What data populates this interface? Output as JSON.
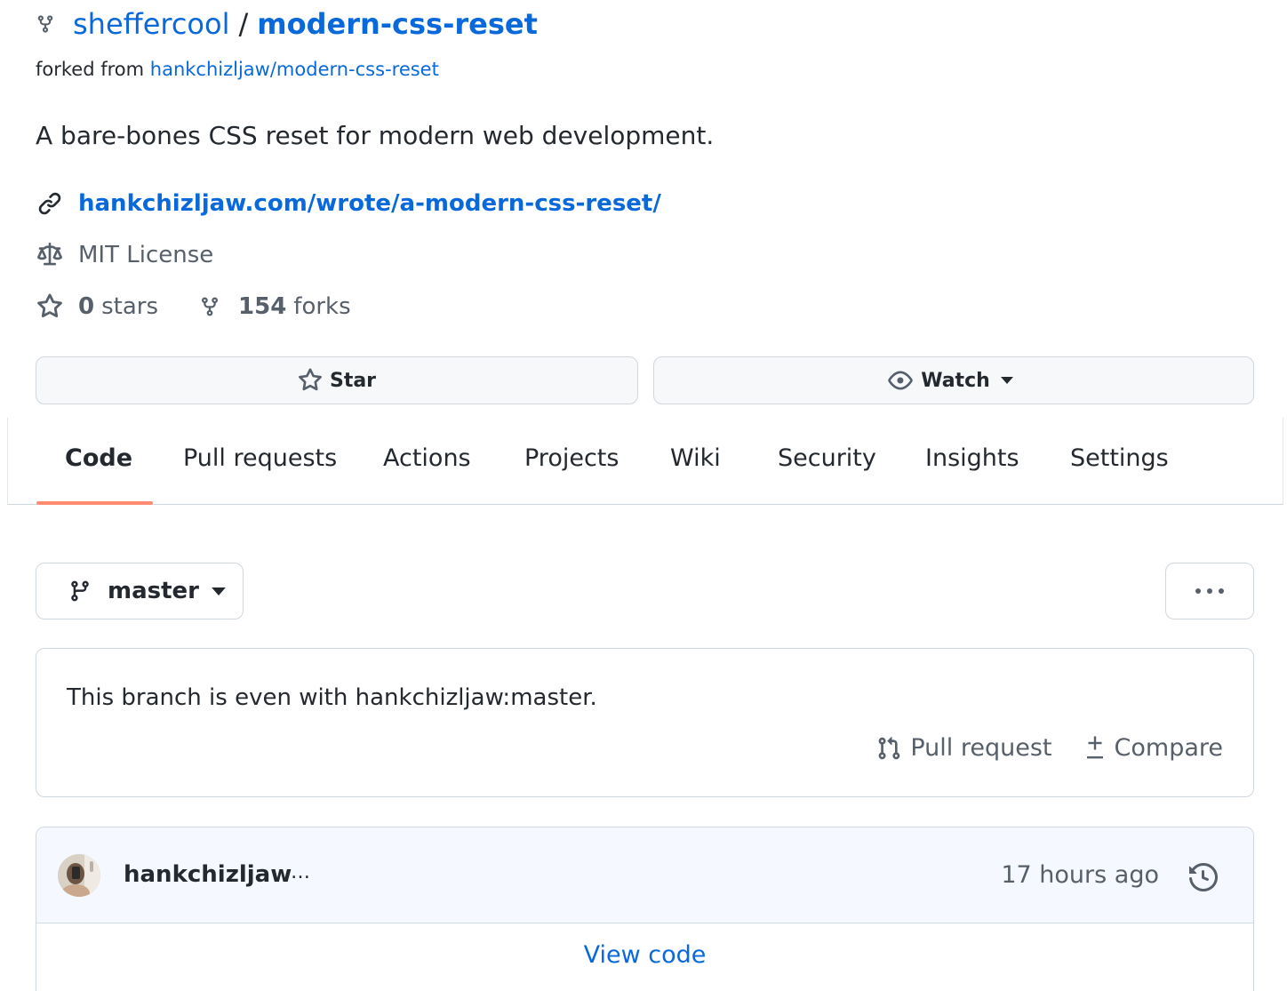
{
  "repo": {
    "owner": "sheffercool",
    "separator": "/",
    "name": "modern-css-reset",
    "forked_prefix": "forked from",
    "forked_source": "hankchizljaw/modern-css-reset",
    "description": "A bare-bones CSS reset for modern web development.",
    "website": "hankchizljaw.com/wrote/a-modern-css-reset/",
    "license": "MIT License",
    "stars_count": "0",
    "stars_label": "stars",
    "forks_count": "154",
    "forks_label": "forks"
  },
  "actions": {
    "star_label": "Star",
    "watch_label": "Watch"
  },
  "tabs": [
    {
      "label": "Code",
      "active": true
    },
    {
      "label": "Pull requests"
    },
    {
      "label": "Actions"
    },
    {
      "label": "Projects"
    },
    {
      "label": "Wiki"
    },
    {
      "label": "Security"
    },
    {
      "label": "Insights"
    },
    {
      "label": "Settings"
    }
  ],
  "branch": {
    "name": "master",
    "status": "This branch is even with hankchizljaw:master.",
    "pull_request_label": "Pull request",
    "compare_label": "Compare"
  },
  "commit": {
    "author": "hankchizljaw",
    "ellipsis": "…",
    "time": "17 hours ago",
    "view_code_label": "View code"
  },
  "colors": {
    "link": "#0969da",
    "muted": "#57606a",
    "tab_underline": "#fd8c73",
    "border": "#d0d7de"
  }
}
